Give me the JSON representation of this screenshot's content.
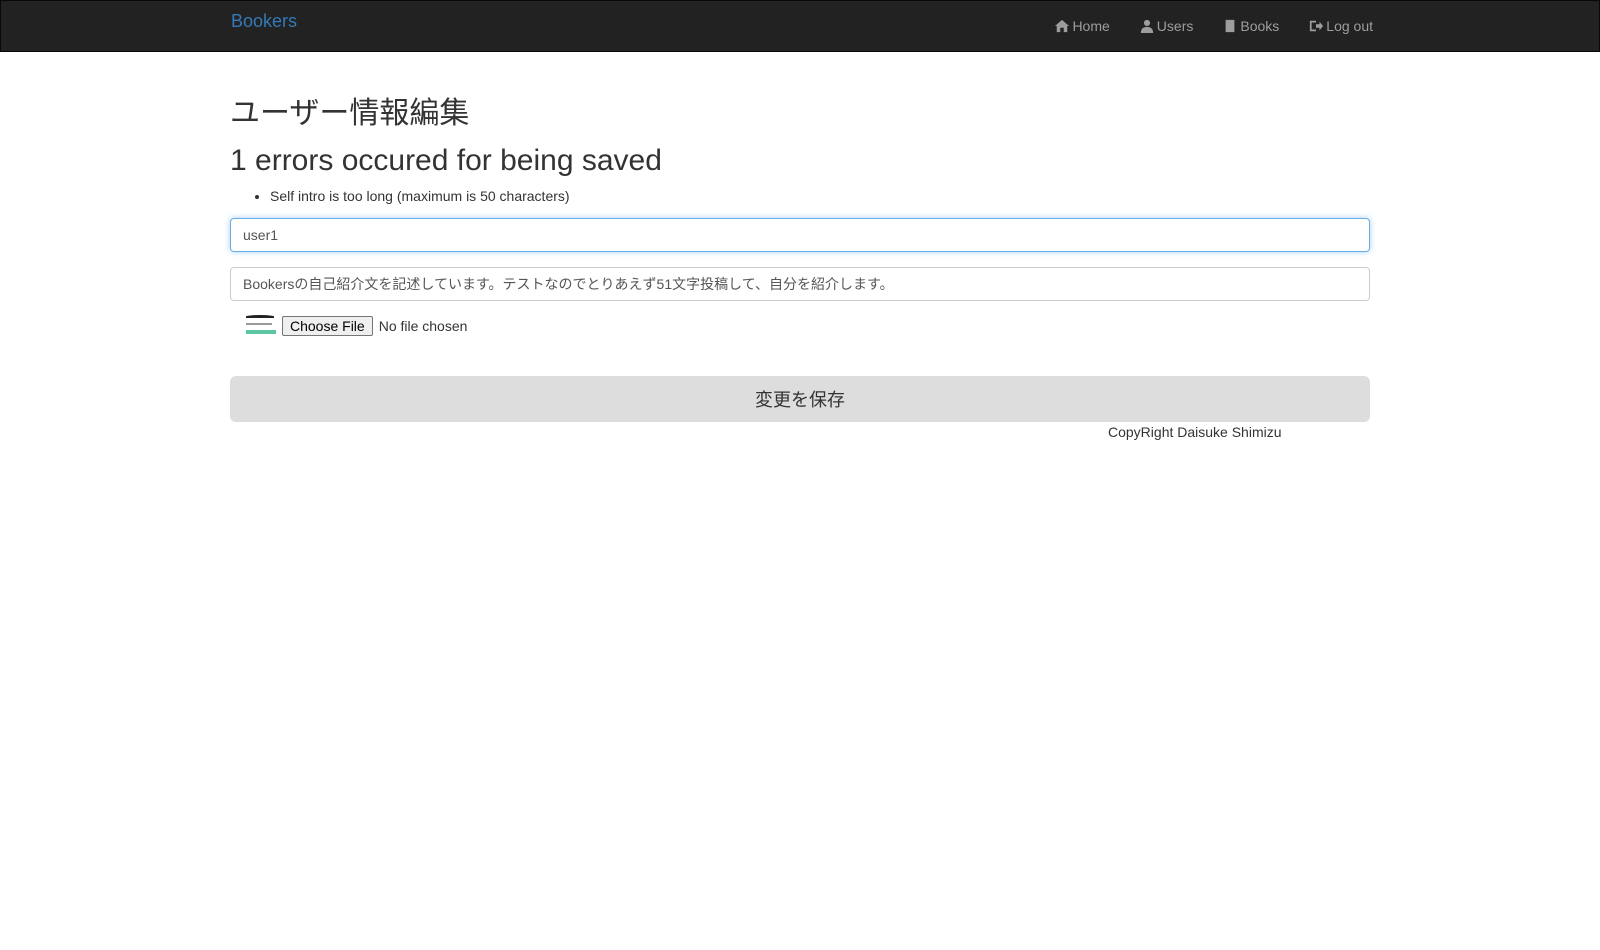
{
  "nav": {
    "brand": "Bookers",
    "links": [
      {
        "label": "Home",
        "icon": "home-icon"
      },
      {
        "label": "Users",
        "icon": "user-icon"
      },
      {
        "label": "Books",
        "icon": "book-icon"
      },
      {
        "label": "Log out",
        "icon": "logout-icon"
      }
    ]
  },
  "page": {
    "title": "ユーザー情報編集",
    "error_heading": "1 errors occured for being saved",
    "errors": [
      "Self intro is too long (maximum is 50 characters)"
    ]
  },
  "form": {
    "name_value": "user1",
    "intro_value": "Bookersの自己紹介文を記述しています。テストなのでとりあえず51文字投稿して、自分を紹介します。",
    "file_button": "Choose File",
    "file_status": "No file chosen",
    "submit": "変更を保存"
  },
  "footer": {
    "text": "CopyRight Daisuke Shimizu"
  },
  "colors": {
    "navbar": "#222222",
    "brand": "#337ab7",
    "focus": "#66afe9"
  }
}
